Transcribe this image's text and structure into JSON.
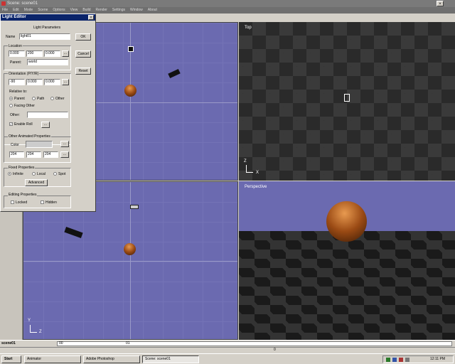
{
  "window": {
    "title": "Scene: scene01",
    "close_glyph": "×"
  },
  "menu": [
    "File",
    "Edit",
    "Mode",
    "Scene",
    "Options",
    "View",
    "Build",
    "Render",
    "Settings",
    "Window",
    "About"
  ],
  "viewports": {
    "top_label": "Top",
    "persp_label": "Perspective",
    "axes": {
      "top": {
        "v": "Z",
        "h": "X"
      },
      "left_bottom": {
        "v": "Y",
        "h": "Z"
      }
    }
  },
  "dialog": {
    "title": "Light Editor",
    "close_glyph": "×",
    "section_params": "Light Parameters",
    "name_label": "Name",
    "name_value": "light01",
    "ok_label": "OK",
    "cancel_label": "Cancel",
    "reset_label": "Reset",
    "location_label": "Location",
    "location_values": [
      "0.000",
      "200",
      "0.000"
    ],
    "parent_label": "Parent:",
    "parent_value": "world",
    "orientation_label": "Orientation (P/Y/R)",
    "orientation_values": [
      "-90",
      "0.000",
      "0.000"
    ],
    "relative_label": "Relative to:",
    "rel_parent": "Parent",
    "rel_path": "Path",
    "rel_other": "Other",
    "rel_facing": "Facing Other",
    "other_label": "Other:",
    "enable_roll": "Enable Roll",
    "other_anim_label": "Other Animated Properties",
    "color_label": "Color",
    "color_values": [
      "204",
      "204",
      "204"
    ],
    "fixed_label": "Fixed Properties",
    "fixed_infinite": "Infinite",
    "fixed_local": "Local",
    "fixed_spot": "Spot",
    "advanced_label": "Advanced",
    "editing_label": "Editing Properties",
    "locked_label": "Locked",
    "hidden_label": "Hidden",
    "ellipsis": "...",
    "checkmark": "✓"
  },
  "status": {
    "scene_name": "scene01",
    "timeline_start": "00",
    "timeline_mid": "01",
    "timeline_right": "0"
  },
  "taskbar": {
    "start_label": "Start",
    "buttons": [
      "Animator",
      "Adobe Photoshop",
      "Scene: scene01"
    ],
    "clock": "12:11 PM"
  }
}
